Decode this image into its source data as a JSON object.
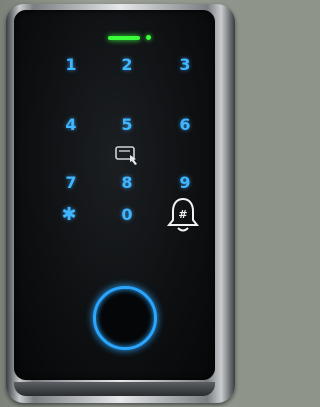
{
  "keypad": {
    "row1": [
      "1",
      "2",
      "3"
    ],
    "row2": [
      "4",
      "5",
      "6"
    ],
    "row3": [
      "7",
      "8",
      "9"
    ],
    "zero": "0",
    "star_symbol": "✱"
  },
  "doorbell": {
    "symbol": "#",
    "icon": "bell-icon"
  },
  "card_reader": {
    "icon": "card-tap-icon"
  },
  "fingerprint": {
    "icon": "fingerprint-ring"
  },
  "colors": {
    "key_glow": "#3fb6ff",
    "led": "#3cff3c",
    "ring": "#2aa6ff",
    "bell": "#f2f2f2"
  }
}
